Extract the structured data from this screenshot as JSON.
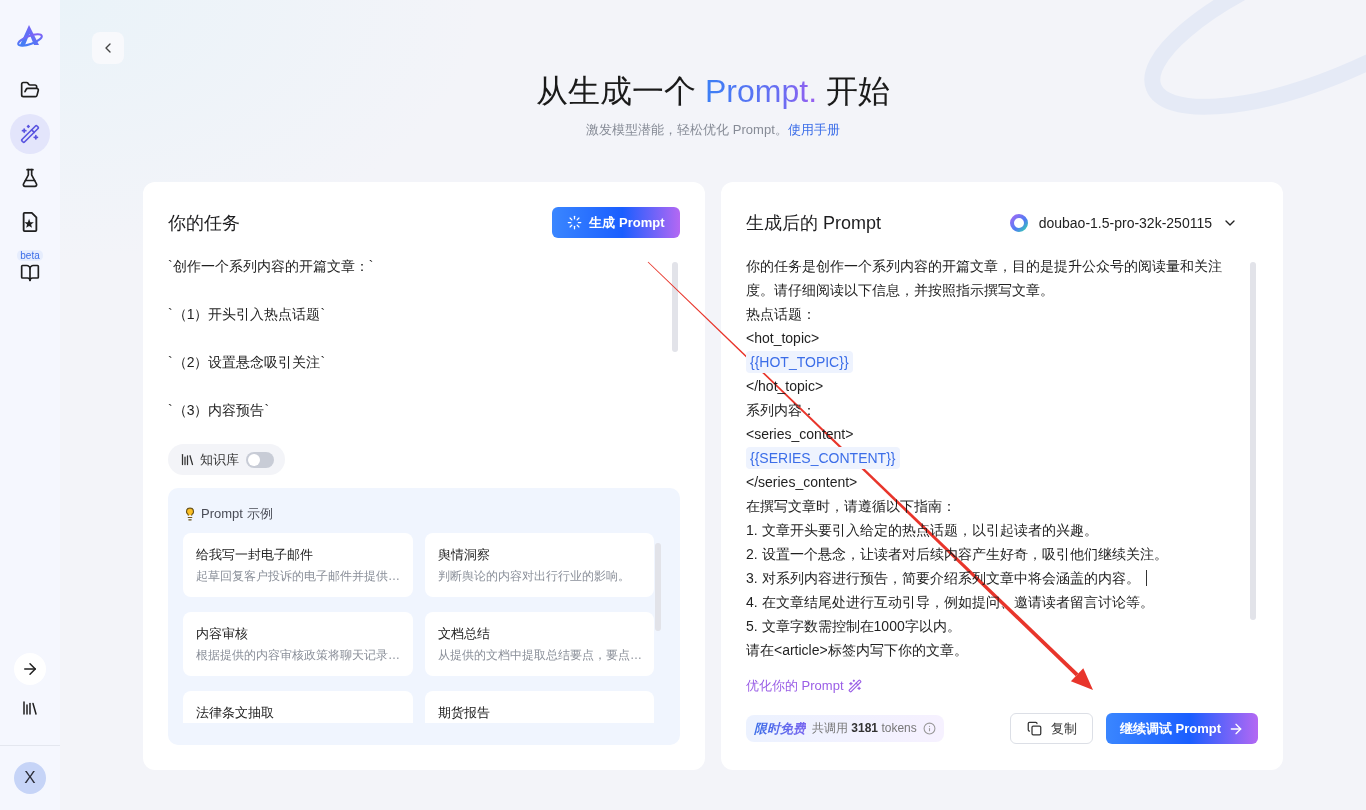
{
  "sidebar": {
    "nav_items": [
      {
        "selected": false
      },
      {
        "selected": true
      },
      {
        "selected": false
      },
      {
        "selected": false
      },
      {
        "selected": false,
        "badge": "beta"
      }
    ],
    "avatar": "X"
  },
  "header": {
    "title": {
      "lead": "从生成一个",
      "highlight": "Prompt.",
      "tail": "开始"
    },
    "subtitle": "激发模型潜能，轻松优化 Prompt。",
    "manual_link": "使用手册"
  },
  "task_panel": {
    "title": "你的任务",
    "generate_button": "生成 Prompt",
    "task_lines": [
      "`创作一个系列内容的开篇文章：`",
      "`（1）开头引入热点话题`",
      "`（2）设置悬念吸引关注`",
      "`（3）内容预告`"
    ],
    "knowledge_base": {
      "label": "知识库",
      "on": false
    },
    "examples": {
      "title": "Prompt 示例",
      "items": [
        {
          "title": "给我写一封电子邮件",
          "description": "起草回复客户投诉的电子邮件并提供…"
        },
        {
          "title": "舆情洞察",
          "description": "判断舆论的内容对出行行业的影响。"
        },
        {
          "title": "内容审核",
          "description": "根据提供的内容审核政策将聊天记录…"
        },
        {
          "title": "文档总结",
          "description": "从提供的文档中提取总结要点，要点…"
        },
        {
          "title": "法律条文抽取"
        },
        {
          "title": "期货报告"
        }
      ]
    }
  },
  "result_panel": {
    "title": "生成后的 Prompt",
    "model": "doubao-1.5-pro-32k-250115",
    "lines": [
      {
        "kind": "text",
        "text": "你的任务是创作一个系列内容的开篇文章，目的是提升公众号的阅读量和关注度。请仔细阅读以下信息，并按照指示撰写文章。"
      },
      {
        "kind": "text",
        "text": "热点话题："
      },
      {
        "kind": "text",
        "text": "<hot_topic>"
      },
      {
        "kind": "variable",
        "text": "{{HOT_TOPIC}}"
      },
      {
        "kind": "text",
        "text": "</hot_topic>"
      },
      {
        "kind": "text",
        "text": "系列内容："
      },
      {
        "kind": "text",
        "text": "<series_content>"
      },
      {
        "kind": "variable",
        "text": "{{SERIES_CONTENT}}"
      },
      {
        "kind": "text",
        "text": "</series_content>"
      },
      {
        "kind": "text",
        "text": "在撰写文章时，请遵循以下指南："
      },
      {
        "kind": "text",
        "text": "1. 文章开头要引入给定的热点话题，以引起读者的兴趣。"
      },
      {
        "kind": "text",
        "text": "2. 设置一个悬念，让读者对后续内容产生好奇，吸引他们继续关注。"
      },
      {
        "kind": "text",
        "text": "3. 对系列内容进行预告，简要介绍系列文章中将会涵盖的内容。",
        "cursor": true
      },
      {
        "kind": "text",
        "text": "4. 在文章结尾处进行互动引导，例如提问、邀请读者留言讨论等。"
      },
      {
        "kind": "text",
        "text": "5. 文章字数需控制在1000字以内。"
      },
      {
        "kind": "text",
        "text": "请在<article>标签内写下你的文章。"
      }
    ],
    "optimize_link": "优化你的 Prompt",
    "usage": {
      "badge": "限时免费",
      "text": "共调用 **3181** tokens"
    },
    "copy_button": "复制",
    "continue_button": "继续调试 Prompt"
  }
}
